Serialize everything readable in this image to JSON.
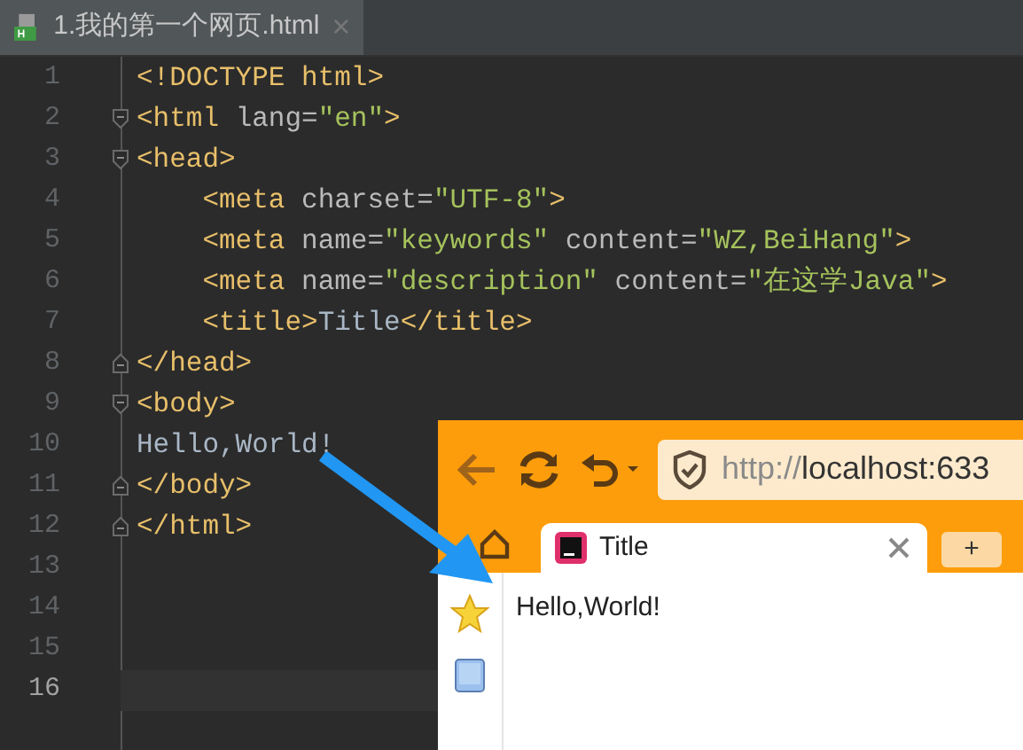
{
  "editor_tab": {
    "title": "1.我的第一个网页.html",
    "selected": true
  },
  "code_lines": [
    {
      "number": "1",
      "fold_start": false,
      "fold_end": false,
      "current": false,
      "tokens": [
        {
          "kind": "tag",
          "text": "<!DOCTYPE html>"
        }
      ]
    },
    {
      "number": "2",
      "fold_start": true,
      "fold_end": false,
      "current": false,
      "tokens": [
        {
          "kind": "tag",
          "text": "<html "
        },
        {
          "kind": "attr",
          "text": "lang="
        },
        {
          "kind": "value",
          "text": "\"en\""
        },
        {
          "kind": "tag",
          "text": ">"
        }
      ]
    },
    {
      "number": "3",
      "fold_start": true,
      "fold_end": false,
      "current": false,
      "tokens": [
        {
          "kind": "tag",
          "text": "<head>"
        }
      ]
    },
    {
      "number": "4",
      "fold_start": false,
      "fold_end": false,
      "current": false,
      "tokens": [
        {
          "kind": "tag",
          "text": "    <meta "
        },
        {
          "kind": "attr",
          "text": "charset="
        },
        {
          "kind": "value",
          "text": "\"UTF-8\""
        },
        {
          "kind": "tag",
          "text": ">"
        }
      ]
    },
    {
      "number": "5",
      "fold_start": false,
      "fold_end": false,
      "current": false,
      "tokens": [
        {
          "kind": "tag",
          "text": "    <meta "
        },
        {
          "kind": "attr",
          "text": "name="
        },
        {
          "kind": "value",
          "text": "\"keywords\" "
        },
        {
          "kind": "attr",
          "text": "content="
        },
        {
          "kind": "value",
          "text": "\"WZ,BeiHang\""
        },
        {
          "kind": "tag",
          "text": ">"
        }
      ]
    },
    {
      "number": "6",
      "fold_start": false,
      "fold_end": false,
      "current": false,
      "tokens": [
        {
          "kind": "tag",
          "text": "    <meta "
        },
        {
          "kind": "attr",
          "text": "name="
        },
        {
          "kind": "value",
          "text": "\"description\" "
        },
        {
          "kind": "attr",
          "text": "content="
        },
        {
          "kind": "value",
          "text": "\"在这学Java\""
        },
        {
          "kind": "tag",
          "text": ">"
        }
      ]
    },
    {
      "number": "7",
      "fold_start": false,
      "fold_end": false,
      "current": false,
      "tokens": [
        {
          "kind": "tag",
          "text": "    <title>"
        },
        {
          "kind": "text",
          "text": "Title"
        },
        {
          "kind": "tag",
          "text": "</title>"
        }
      ]
    },
    {
      "number": "8",
      "fold_start": false,
      "fold_end": true,
      "current": false,
      "tokens": [
        {
          "kind": "tag",
          "text": "</head>"
        }
      ]
    },
    {
      "number": "9",
      "fold_start": true,
      "fold_end": false,
      "current": false,
      "tokens": [
        {
          "kind": "tag",
          "text": "<body>"
        }
      ]
    },
    {
      "number": "10",
      "fold_start": false,
      "fold_end": false,
      "current": false,
      "tokens": [
        {
          "kind": "text",
          "text": "Hello,World!"
        }
      ]
    },
    {
      "number": "11",
      "fold_start": false,
      "fold_end": true,
      "current": false,
      "tokens": [
        {
          "kind": "tag",
          "text": "</body>"
        }
      ]
    },
    {
      "number": "12",
      "fold_start": false,
      "fold_end": true,
      "current": false,
      "tokens": [
        {
          "kind": "tag",
          "text": "</html>"
        }
      ]
    },
    {
      "number": "13",
      "current": false
    },
    {
      "number": "14",
      "current": false
    },
    {
      "number": "15",
      "current": false
    },
    {
      "number": "16",
      "current": true
    }
  ],
  "browser": {
    "url_scheme": "http://",
    "url_rest": "localhost:633",
    "tab": {
      "title": "Title",
      "selected": true
    },
    "page_text": "Hello,World!",
    "new_tab": "+"
  }
}
